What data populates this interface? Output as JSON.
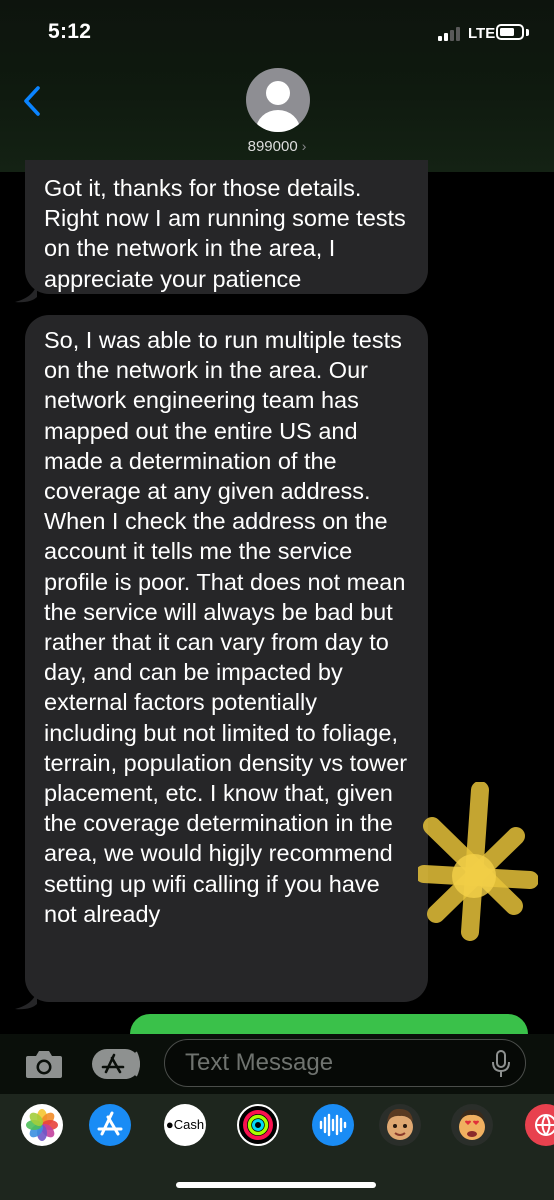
{
  "status_bar": {
    "time": "5:12",
    "network": "LTE"
  },
  "header": {
    "contact_name": "899000",
    "chevron": "›"
  },
  "messages": [
    {
      "direction": "incoming",
      "text": "Got it, thanks for those details. Right now I am running some tests on the network in the area, I appreciate your patience"
    },
    {
      "direction": "incoming",
      "text": "So, I was able to run multiple tests on the network in the area. Our network engineering team has mapped out the entire US and made a determination of the coverage at any given address. When I check the address on the account it tells me the service profile is poor. That does not mean the service will always be bad but rather that it can vary from day to day, and can be impacted by external factors potentially including but not limited to foliage, terrain, population density vs tower placement, etc. I know that, given the coverage determination in the area, we would higjly recommend setting up wifi calling if you have not already"
    }
  ],
  "input": {
    "placeholder": "Text Message"
  },
  "app_strip": {
    "apps": [
      {
        "name": "photos-icon"
      },
      {
        "name": "app-store-icon"
      },
      {
        "name": "apple-cash-icon",
        "label": "Cash"
      },
      {
        "name": "activity-icon"
      },
      {
        "name": "audio-message-icon"
      },
      {
        "name": "memoji-icon"
      },
      {
        "name": "memoji-stickers-icon"
      },
      {
        "name": "web-icon"
      }
    ]
  },
  "colors": {
    "incoming_bubble": "#262628",
    "outgoing_bubble": "#3ac14a",
    "accent": "#0a84ff"
  }
}
